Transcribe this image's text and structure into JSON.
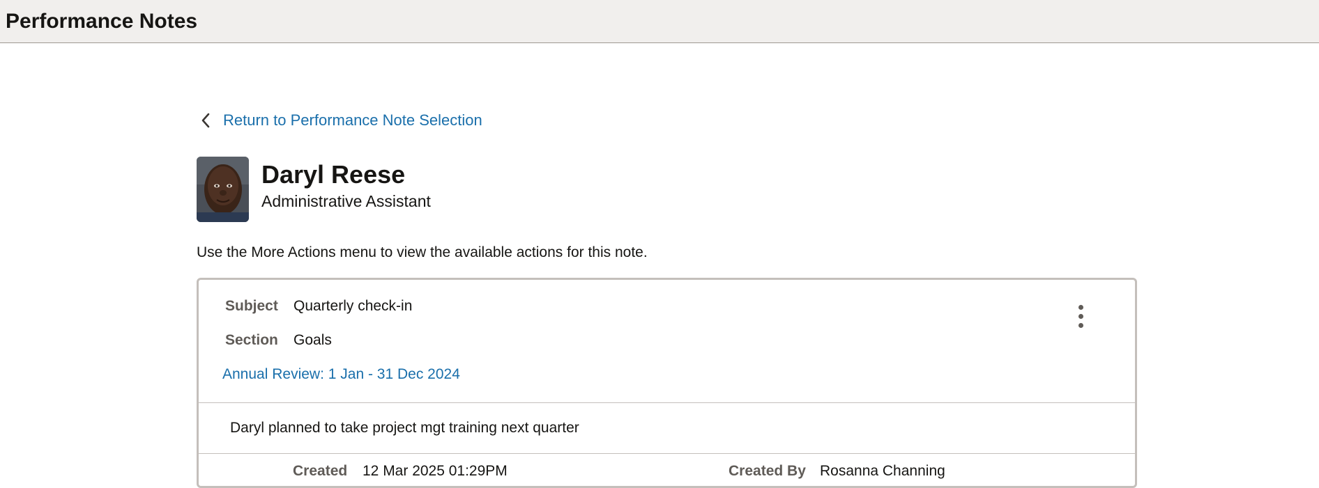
{
  "header": {
    "title": "Performance Notes"
  },
  "back_link": {
    "label": "Return to Performance Note Selection",
    "icon": "chevron-left-icon"
  },
  "employee": {
    "name": "Daryl Reese",
    "job_title": "Administrative Assistant",
    "photo": "employee-photo"
  },
  "instructions": "Use the More Actions menu to view the available actions for this note.",
  "note": {
    "subject_label": "Subject",
    "subject_value": "Quarterly check-in",
    "section_label": "Section",
    "section_value": "Goals",
    "review_link": "Annual Review: 1 Jan - 31 Dec 2024",
    "body": "Daryl planned to take project mgt training next quarter",
    "created_label": "Created",
    "created_value": "12 Mar 2025 01:29PM",
    "created_by_label": "Created By",
    "created_by_value": "Rosanna Channing",
    "more_actions_icon": "vertical-ellipsis-icon"
  },
  "colors": {
    "link": "#1a6fab",
    "header_bg": "#f1efed",
    "label": "#5f5b57",
    "border": "#c4bfbb"
  }
}
